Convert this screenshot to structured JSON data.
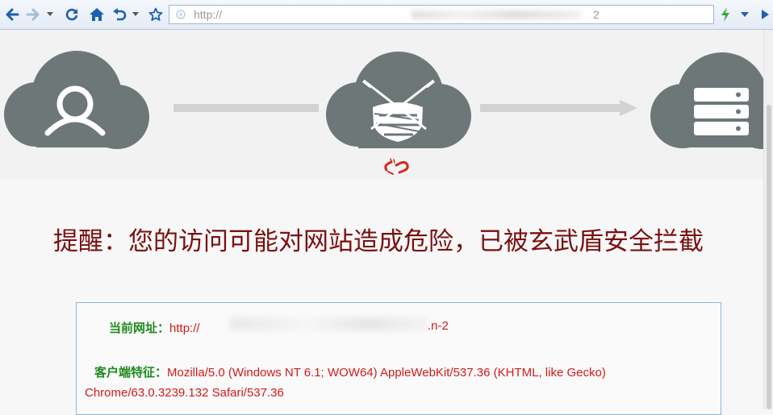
{
  "browser": {
    "url_prefix": "http://",
    "url_suffix": "2"
  },
  "icons": {
    "back": "arrow-left-icon",
    "forward": "arrow-right-icon",
    "refresh": "refresh-icon",
    "home": "home-icon",
    "undo": "undo-icon",
    "favorite": "star-icon",
    "bolt": "bolt-icon",
    "user": "user-cloud-icon",
    "shield": "shield-cloud-icon",
    "server": "server-cloud-icon",
    "broken_link": "broken-link-icon"
  },
  "page": {
    "headline": "提醒：您的访问可能对网站造成危险，已被玄武盾安全拦截",
    "current_url_label": "当前网址：",
    "current_url_prefix": "http://",
    "current_url_suffix": ".n-2",
    "client_label": "客户端特征：",
    "client_value_line1": "Mozilla/5.0 (Windows NT 6.1; WOW64) AppleWebKit/537.36 (KHTML, like Gecko)",
    "client_value_line2": "Chrome/63.0.3239.132 Safari/537.36"
  },
  "colors": {
    "headline": "#7a1010",
    "label": "#1f8a1f",
    "value": "#d21a1a",
    "cloud": "#6e7778",
    "arrow": "#d2d2d2",
    "broken_link": "#d62a1e",
    "box_border": "#8db4d6"
  }
}
